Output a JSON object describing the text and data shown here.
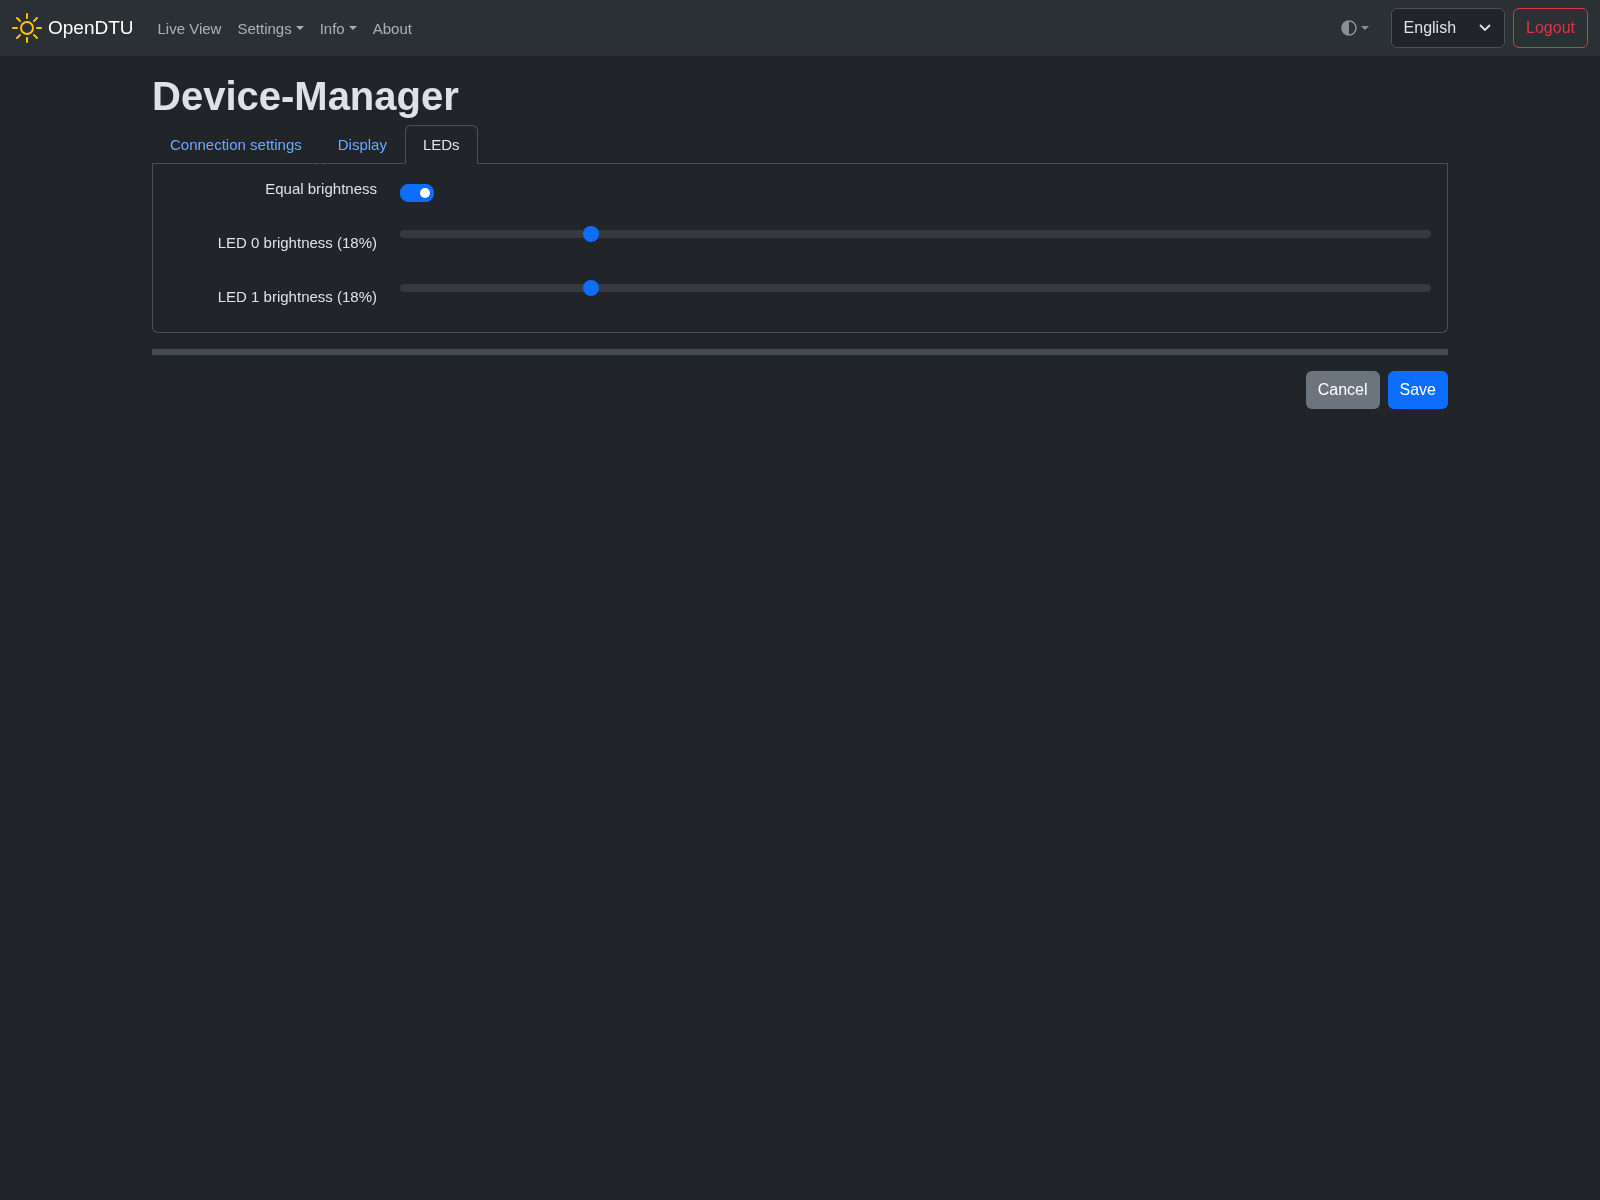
{
  "navbar": {
    "brand": "OpenDTU",
    "items": [
      {
        "label": "Live View",
        "dropdown": false
      },
      {
        "label": "Settings",
        "dropdown": true
      },
      {
        "label": "Info",
        "dropdown": true
      },
      {
        "label": "About",
        "dropdown": false
      }
    ],
    "language": "English",
    "logout": "Logout"
  },
  "heading": "Device-Manager",
  "tabs": [
    {
      "label": "Connection settings",
      "selected": false
    },
    {
      "label": "Display",
      "selected": false
    },
    {
      "label": "LEDs",
      "selected": true
    }
  ],
  "settings": [
    {
      "kind": "switch",
      "label": "Equal brightness",
      "on": true
    },
    {
      "kind": "slider",
      "label": "LED 0 brightness (18%)",
      "level": 0.18
    },
    {
      "kind": "slider",
      "label": "LED 1 brightness (18%)",
      "level": 0.18
    }
  ],
  "buttons": [
    {
      "label": "Cancel",
      "kind": "secondary"
    },
    {
      "label": "Save",
      "kind": "primary"
    }
  ]
}
